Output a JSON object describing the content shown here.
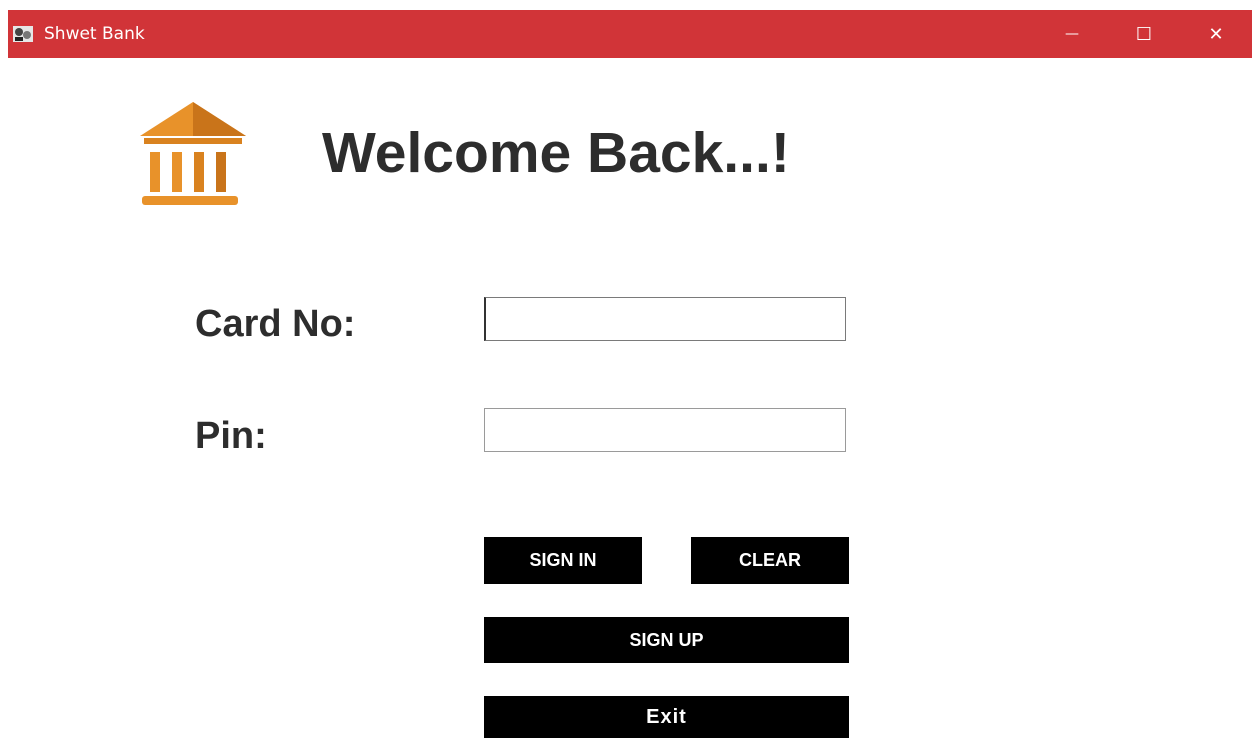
{
  "window": {
    "title": "Shwet Bank",
    "controls": {
      "minimize": "—",
      "maximize": "☐",
      "close": "✕"
    },
    "accent_color": "#d13438"
  },
  "header": {
    "heading": "Welcome Back...!",
    "logo_icon": "bank-icon",
    "logo_color": "#e8922a"
  },
  "form": {
    "card_label": "Card No:",
    "card_value": "",
    "pin_label": "Pin:",
    "pin_value": ""
  },
  "buttons": {
    "sign_in": "SIGN IN",
    "clear": "CLEAR",
    "sign_up": "SIGN UP",
    "exit": "Exit"
  }
}
